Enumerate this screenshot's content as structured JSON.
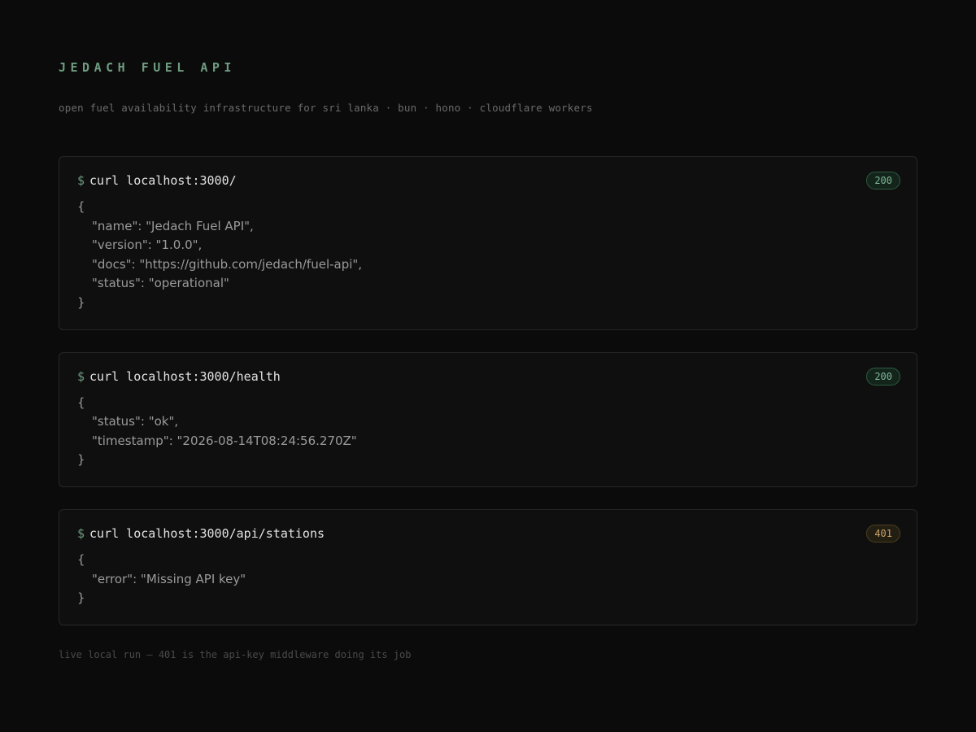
{
  "header": {
    "title": "JEDACH FUEL API",
    "subtitle": "open fuel availability infrastructure for sri lanka · bun · hono · cloudflare workers"
  },
  "cards": [
    {
      "prompt": "$",
      "command": "curl localhost:3000/",
      "status": "200",
      "status_kind": "ok",
      "open": "{",
      "lines": [
        "\"name\": \"Jedach Fuel API\",",
        "\"version\": \"1.0.0\",",
        "\"docs\": \"https://github.com/jedach/fuel-api\",",
        "\"status\": \"operational\""
      ],
      "close": "}"
    },
    {
      "prompt": "$",
      "command": "curl localhost:3000/health",
      "status": "200",
      "status_kind": "ok",
      "open": "{",
      "lines": [
        "\"status\": \"ok\",",
        "\"timestamp\": \"2026-08-14T08:24:56.270Z\""
      ],
      "close": "}"
    },
    {
      "prompt": "$",
      "command": "curl localhost:3000/api/stations",
      "status": "401",
      "status_kind": "warn",
      "open": "{",
      "lines": [
        "\"error\": \"Missing API key\""
      ],
      "close": "}"
    }
  ],
  "footer": {
    "note": "live local run — 401 is the api-key middleware doing its job"
  },
  "colors": {
    "background": "#0b0b0b",
    "accent": "#6f9c80",
    "ok": "#7fb596",
    "warn": "#c9a36a"
  }
}
